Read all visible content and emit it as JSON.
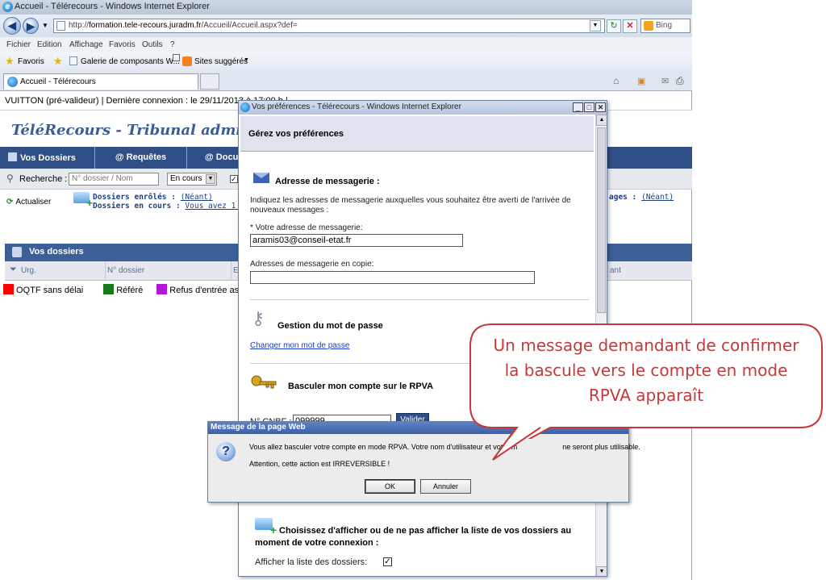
{
  "browser": {
    "title": "Accueil - Télérecours - Windows Internet Explorer",
    "url_prefix": "http://",
    "url_domain": "formation.tele-recours.juradm.fr",
    "url_path": "/Accueil/Accueil.aspx?def=",
    "search_placeholder": "Bing",
    "menu": [
      "Fichier",
      "Edition",
      "Affichage",
      "Favoris",
      "Outils",
      "?"
    ],
    "favorites_label": "Favoris",
    "fav_items": [
      "Galerie de composants W...",
      "Sites suggérés"
    ],
    "tab_label": "Accueil - Télérecours"
  },
  "page": {
    "status_line": "VUITTON (pré-valideur) | Dernière connexion : le 29/11/2013 à 17:00 h |",
    "app_title": "TéléRecours - Tribunal adminis",
    "nav_tabs": [
      "Vos Dossiers",
      "@ Requêtes",
      "@ Docu"
    ],
    "search_label": "Recherche :",
    "search_placeholder": "N° dossier / Nom",
    "status_value": "En cours",
    "refresh_label": "Actualiser",
    "enrolled_label": "Dossiers enrôlés :",
    "enrolled_value": "(Néant)",
    "ongoing_label": "Dossiers en cours :",
    "ongoing_value": "Vous avez 1 dos",
    "right_label": "ages :",
    "right_value": "(Néant)",
    "dossiers_bar": "Vos dossiers",
    "columns": [
      "Urg.",
      "N° dossier",
      "E",
      "ant"
    ],
    "legend": [
      {
        "label": "OQTF sans délai",
        "color": "#ff0000"
      },
      {
        "label": "Référé",
        "color": "#1a7a1a"
      },
      {
        "label": "Refus d'entrée as",
        "color": "#b018d6"
      }
    ]
  },
  "popup": {
    "title": "Vos préférences - Télérecours - Windows Internet Explorer",
    "header": "Gérez vos préférences",
    "email_section_title": "Adresse de messagerie :",
    "email_intro": "Indiquez les adresses de messagerie auxquelles vous souhaitez être averti de l'arrivée de nouveaux messages :",
    "email_label": "* Votre adresse de messagerie:",
    "email_value": "aramis03@conseil-etat.fr",
    "cc_label": "Adresses de messagerie en copie:",
    "cc_value": "",
    "pwd_section_title": "Gestion du mot de passe",
    "pwd_link": "Changer mon mot de passe",
    "rpva_section_title": "Basculer mon compte sur le RPVA",
    "cnbf_label": "N° CNBF :",
    "cnbf_value": "099999",
    "validate_label": "Valider",
    "display_section_title": "Choisissez d'afficher ou de ne pas afficher la liste de vos dossiers au moment de votre connexion :",
    "display_checkbox_label": "Afficher la liste des dossiers:",
    "display_checked": "✓"
  },
  "alert": {
    "title": "Message de la page Web",
    "message": "Vous allez basculer votre compte en mode RPVA. Votre nom d'utilisateur et votre m",
    "message_tail": "ne seront plus utilisable.",
    "warning": "Attention, cette action est IRREVERSIBLE !",
    "ok_label": "OK",
    "cancel_label": "Annuler"
  },
  "callout": {
    "text": "Un message demandant de confirmer la bascule vers le compte en mode RPVA apparaît",
    "color": "#c43a3a"
  }
}
